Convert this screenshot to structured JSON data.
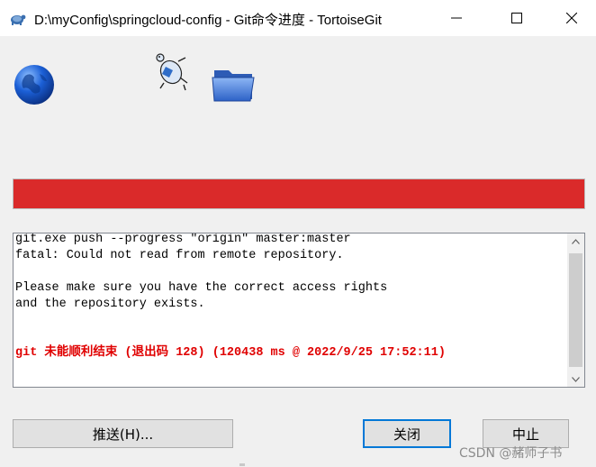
{
  "window": {
    "title": "D:\\myConfig\\springcloud-config - Git命令进度 - TortoiseGit",
    "icons": {
      "app": "tortoisegit-app-icon",
      "minimize": "minimize-icon",
      "maximize": "maximize-icon",
      "close": "close-icon"
    }
  },
  "animation": {
    "icons": [
      "globe-icon",
      "turtle-icon",
      "folder-icon"
    ]
  },
  "progress": {
    "fraction": 1.0,
    "color": "#da2a2a",
    "state": "error"
  },
  "log": {
    "lines": [
      "git.exe push --progress \"origin\" master:master",
      "fatal: Could not read from remote repository.",
      "",
      "Please make sure you have the correct access rights",
      "and the repository exists.",
      "",
      "",
      "git 未能顺利结束 (退出码 128) (120438 ms @ 2022/9/25 17:52:11)"
    ],
    "error_color": "#e00000"
  },
  "buttons": {
    "push": "推送(H)...",
    "close": "关闭",
    "abort": "中止"
  },
  "watermark": "CSDN @赭师子书"
}
